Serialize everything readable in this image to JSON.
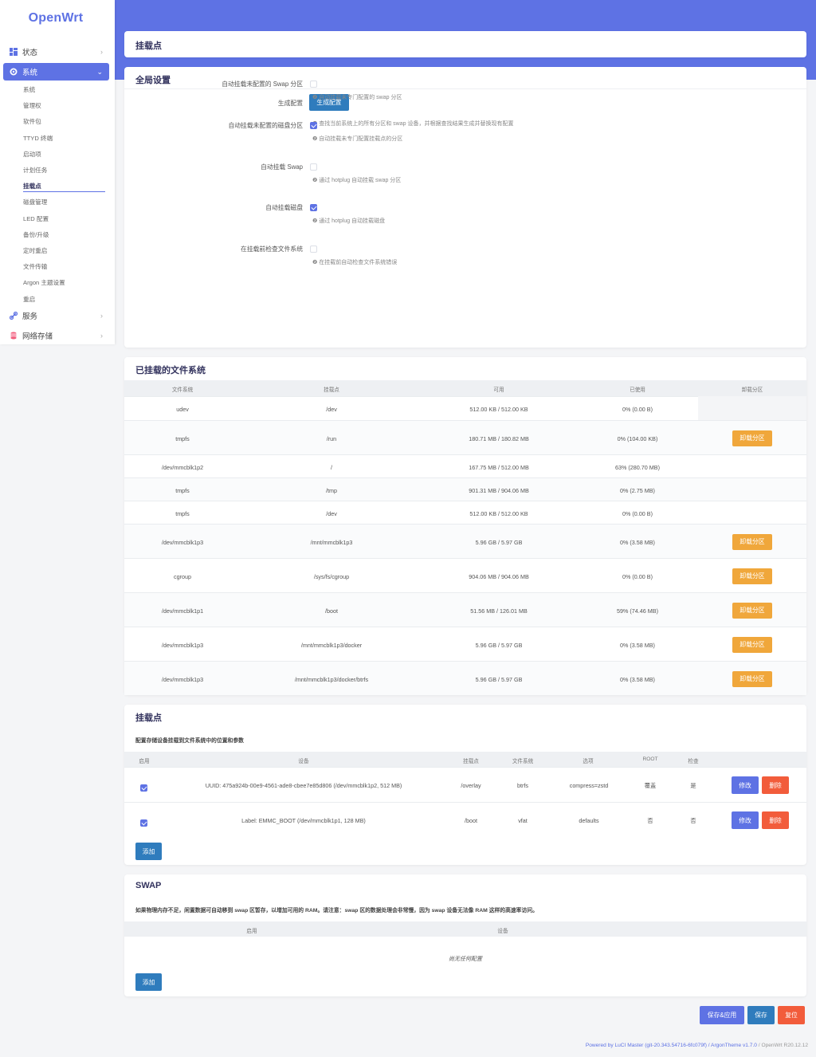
{
  "sidebar": {
    "logo": "OpenWrt",
    "items": [
      {
        "label": "状态",
        "icon": "dashboard-icon"
      },
      {
        "label": "系统",
        "icon": "gear-icon"
      },
      {
        "label": "服务",
        "icon": "link-icon"
      },
      {
        "label": "网络存储",
        "icon": "database-icon"
      }
    ],
    "submenu": [
      "系统",
      "管理权",
      "软件包",
      "TTYD 终端",
      "启动项",
      "计划任务",
      "挂载点",
      "磁盘管理",
      "LED 配置",
      "备份/升级",
      "定时重启",
      "文件传输",
      "Argon 主题设置",
      "重启"
    ],
    "current": "挂载点"
  },
  "page": {
    "title": "挂载点"
  },
  "global": {
    "title": "全局设置",
    "generate_label": "生成配置",
    "generate_button": "生成配置",
    "generate_hint": "❷ 查找当前系统上的所有分区和 swap 设备，并根据查找结果生成并替换现有配置",
    "options": [
      {
        "label": "自动挂载未配置的 Swap 分区",
        "checked": false,
        "hint": "❷ 自动挂载未专门配置的 swap 分区"
      },
      {
        "label": "自动挂载未配置的磁盘分区",
        "checked": true,
        "hint": "❷ 自动挂载未专门配置挂载点的分区"
      },
      {
        "label": "自动挂载 Swap",
        "checked": false,
        "hint": "❷ 通过 hotplug 自动挂载 swap 分区"
      },
      {
        "label": "自动挂载磁盘",
        "checked": true,
        "hint": "❷ 通过 hotplug 自动挂载磁盘"
      },
      {
        "label": "在挂载前检查文件系统",
        "checked": false,
        "hint": "❷ 在挂载前自动检查文件系统错误"
      }
    ]
  },
  "mounted": {
    "title": "已挂载的文件系统",
    "headers": [
      "文件系统",
      "挂载点",
      "可用",
      "已使用",
      "卸载分区"
    ],
    "unmount_label": "卸载分区",
    "rows": [
      {
        "fs": "udev",
        "mp": "/dev",
        "avail": "512.00 KB / 512.00 KB",
        "used": "0% (0.00 B)",
        "btn": false
      },
      {
        "fs": "tmpfs",
        "mp": "/run",
        "avail": "180.71 MB / 180.82 MB",
        "used": "0% (104.00 KB)",
        "btn": true
      },
      {
        "fs": "/dev/mmcblk1p2",
        "mp": "/",
        "avail": "167.75 MB / 512.00 MB",
        "used": "63% (280.70 MB)",
        "btn": false
      },
      {
        "fs": "tmpfs",
        "mp": "/tmp",
        "avail": "901.31 MB / 904.06 MB",
        "used": "0% (2.75 MB)",
        "btn": false
      },
      {
        "fs": "tmpfs",
        "mp": "/dev",
        "avail": "512.00 KB / 512.00 KB",
        "used": "0% (0.00 B)",
        "btn": false
      },
      {
        "fs": "/dev/mmcblk1p3",
        "mp": "/mnt/mmcblk1p3",
        "avail": "5.96 GB / 5.97 GB",
        "used": "0% (3.58 MB)",
        "btn": true
      },
      {
        "fs": "cgroup",
        "mp": "/sys/fs/cgroup",
        "avail": "904.06 MB / 904.06 MB",
        "used": "0% (0.00 B)",
        "btn": true
      },
      {
        "fs": "/dev/mmcblk1p1",
        "mp": "/boot",
        "avail": "51.56 MB / 126.01 MB",
        "used": "59% (74.46 MB)",
        "btn": true
      },
      {
        "fs": "/dev/mmcblk1p3",
        "mp": "/mnt/mmcblk1p3/docker",
        "avail": "5.96 GB / 5.97 GB",
        "used": "0% (3.58 MB)",
        "btn": true
      },
      {
        "fs": "/dev/mmcblk1p3",
        "mp": "/mnt/mmcblk1p3/docker/btrfs",
        "avail": "5.96 GB / 5.97 GB",
        "used": "0% (3.58 MB)",
        "btn": true
      }
    ]
  },
  "mountpoints": {
    "title": "挂载点",
    "description": "配置存储设备挂载到文件系统中的位置和参数",
    "headers": [
      "启用",
      "设备",
      "挂载点",
      "文件系统",
      "选项",
      "ROOT",
      "检查"
    ],
    "edit_label": "修改",
    "delete_label": "删除",
    "add_label": "添加",
    "rows": [
      {
        "enabled": true,
        "device": "UUID: 475a924b-00e9-4561-ade8-cbee7e85d806 (/dev/mmcblk1p2, 512 MB)",
        "mp": "/overlay",
        "fs": "btrfs",
        "opts": "compress=zstd",
        "root": "覆盖",
        "check": "是"
      },
      {
        "enabled": true,
        "device": "Label: EMMC_BOOT (/dev/mmcblk1p1, 128 MB)",
        "mp": "/boot",
        "fs": "vfat",
        "opts": "defaults",
        "root": "否",
        "check": "否"
      }
    ]
  },
  "swap": {
    "title": "SWAP",
    "description": "如果物理内存不足，闲置数据可自动移到 swap 区暂存，以增加可用的 RAM。请注意：swap 区的数据处理会非常慢，因为 swap 设备无法像 RAM 这样的高速率访问。",
    "headers": [
      "启用",
      "设备"
    ],
    "empty": "尚无任何配置",
    "add_label": "添加"
  },
  "actions": {
    "save_apply": "保存&应用",
    "save": "保存",
    "reset": "复位"
  },
  "footer": {
    "powered": "Powered by LuCI Master (git-20.343.54716-6fc079f) / ArgonTheme v1.7.0",
    "version": " / OpenWrt R20.12.12"
  },
  "colors": {
    "primary": "#5e72e4",
    "orange": "#f0a73b",
    "red": "#f25c3b",
    "blue": "#2f7cbd"
  }
}
